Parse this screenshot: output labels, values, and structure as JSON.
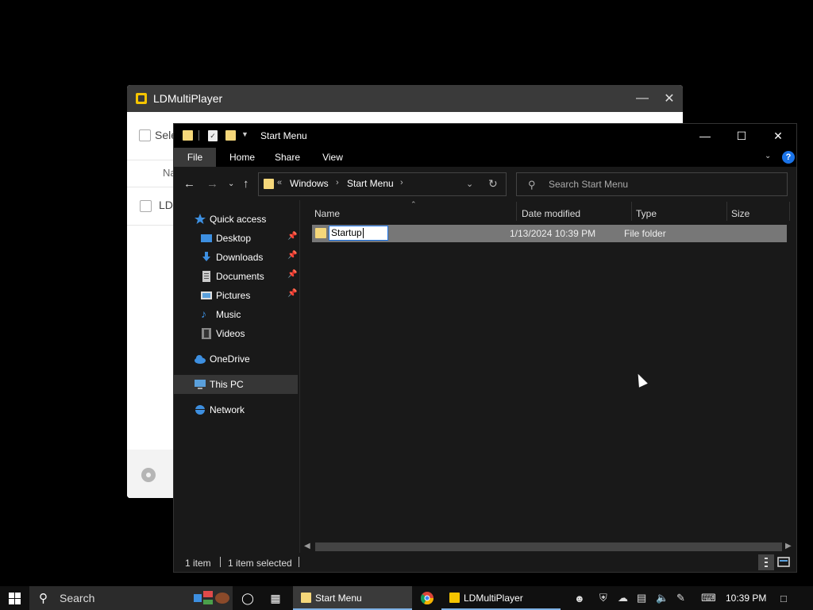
{
  "ld_window": {
    "title": "LDMultiPlayer",
    "select_label": "Sele",
    "col_name": "Na",
    "row_label": "LD"
  },
  "explorer": {
    "title": "Start Menu",
    "ribbon_tabs": [
      "File",
      "Home",
      "Share",
      "View"
    ],
    "address": {
      "chevron": "«",
      "segments": [
        "Windows",
        "Start Menu"
      ]
    },
    "search_placeholder": "Search Start Menu",
    "nav_pane": [
      {
        "label": "Quick access",
        "icon": "star-icon"
      },
      {
        "label": "Desktop",
        "icon": "desktop-icon",
        "pinned": true
      },
      {
        "label": "Downloads",
        "icon": "download-icon",
        "pinned": true
      },
      {
        "label": "Documents",
        "icon": "document-icon",
        "pinned": true
      },
      {
        "label": "Pictures",
        "icon": "pictures-icon",
        "pinned": true
      },
      {
        "label": "Music",
        "icon": "music-icon"
      },
      {
        "label": "Videos",
        "icon": "videos-icon"
      },
      {
        "label": "OneDrive",
        "icon": "cloud-icon"
      },
      {
        "label": "This PC",
        "icon": "computer-icon",
        "selected": true
      },
      {
        "label": "Network",
        "icon": "network-icon"
      }
    ],
    "columns": [
      "Name",
      "Date modified",
      "Type",
      "Size"
    ],
    "files": [
      {
        "name": "Startup",
        "date_modified": "1/13/2024 10:39 PM",
        "type": "File folder",
        "size": "",
        "renaming": true
      }
    ],
    "status": {
      "item_count": "1 item",
      "selected_count": "1 item selected"
    }
  },
  "taskbar": {
    "search_label": "Search",
    "apps": [
      {
        "label": "Start Menu",
        "icon": "folder-icon",
        "active": true
      },
      {
        "label": "LDMultiPlayer",
        "icon": "ldplayer-icon",
        "active": false
      }
    ],
    "clock": "10:39 PM"
  },
  "colors": {
    "accent": "#1a73e8",
    "folder": "#f5d77a",
    "ld_brand": "#f5c400",
    "selected_row": "#777777"
  }
}
